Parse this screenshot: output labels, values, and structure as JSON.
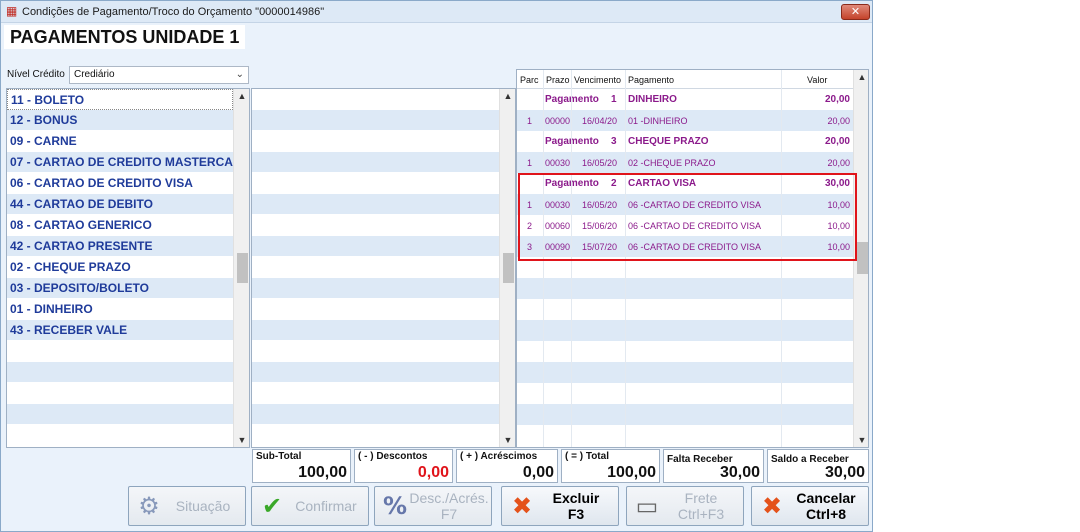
{
  "window": {
    "title": "Condições de Pagamento/Troco do Orçamento \"0000014986\"",
    "close_glyph": "✕"
  },
  "header": {
    "title": "PAGAMENTOS UNIDADE 1"
  },
  "nivel_credito": {
    "label": "Nível Crédito",
    "value": "Crediário"
  },
  "payment_types": [
    "11 - BOLETO",
    "12 - BONUS",
    "09 - CARNE",
    "07 - CARTAO DE CREDITO MASTERCARD",
    "06 - CARTAO DE CREDITO VISA",
    "44 - CARTAO DE DEBITO",
    "08 - CARTAO GENERICO",
    "42 - CARTAO PRESENTE",
    "02 - CHEQUE PRAZO",
    "03 - DEPOSITO/BOLETO",
    "01 - DINHEIRO",
    "43 - RECEBER VALE"
  ],
  "installments": {
    "columns": [
      "Parc",
      "Prazo",
      "Vencimento",
      "Pagamento",
      "Valor"
    ],
    "rows": [
      {
        "type": "group",
        "label": "Pagamento",
        "num": "1",
        "pagamento": "DINHEIRO",
        "valor": "20,00"
      },
      {
        "type": "item",
        "parc": "1",
        "prazo": "00000",
        "venc": "16/04/20",
        "pagamento": "01 -DINHEIRO",
        "valor": "20,00"
      },
      {
        "type": "group",
        "label": "Pagamento",
        "num": "3",
        "pagamento": "CHEQUE PRAZO",
        "valor": "20,00"
      },
      {
        "type": "item",
        "parc": "1",
        "prazo": "00030",
        "venc": "16/05/20",
        "pagamento": "02 -CHEQUE PRAZO",
        "valor": "20,00"
      },
      {
        "type": "group",
        "label": "Pagamento",
        "num": "2",
        "pagamento": "CARTAO VISA",
        "valor": "30,00"
      },
      {
        "type": "item",
        "parc": "1",
        "prazo": "00030",
        "venc": "16/05/20",
        "pagamento": "06 -CARTAO DE CREDITO VISA",
        "valor": "10,00"
      },
      {
        "type": "item",
        "parc": "2",
        "prazo": "00060",
        "venc": "15/06/20",
        "pagamento": "06 -CARTAO DE CREDITO VISA",
        "valor": "10,00"
      },
      {
        "type": "item",
        "parc": "3",
        "prazo": "00090",
        "venc": "15/07/20",
        "pagamento": "06 -CARTAO DE CREDITO VISA",
        "valor": "10,00"
      }
    ]
  },
  "totals": {
    "subtotal": {
      "label": "Sub-Total",
      "value": "100,00"
    },
    "descontos": {
      "label": "( - ) Descontos",
      "value": "0,00"
    },
    "acrescimos": {
      "label": "( + ) Acréscimos",
      "value": "0,00"
    },
    "total": {
      "label": "( = ) Total",
      "value": "100,00"
    },
    "falta_receber": {
      "label": "Falta Receber",
      "value": "30,00"
    },
    "saldo_receber": {
      "label": "Saldo a Receber",
      "value": "30,00"
    }
  },
  "buttons": {
    "situacao": "Situação",
    "confirmar": "Confirmar",
    "desc_acres": "Desc./Acrés.\nF7",
    "excluir": "Excluir\nF3",
    "frete": "Frete\nCtrl+F3",
    "cancelar": "Cancelar\nCtrl+8"
  },
  "colors": {
    "accent": "#1f3b9a",
    "group_text": "#8b1a8b",
    "highlight": "#e0141b",
    "row_alt": "#dde9f6"
  }
}
